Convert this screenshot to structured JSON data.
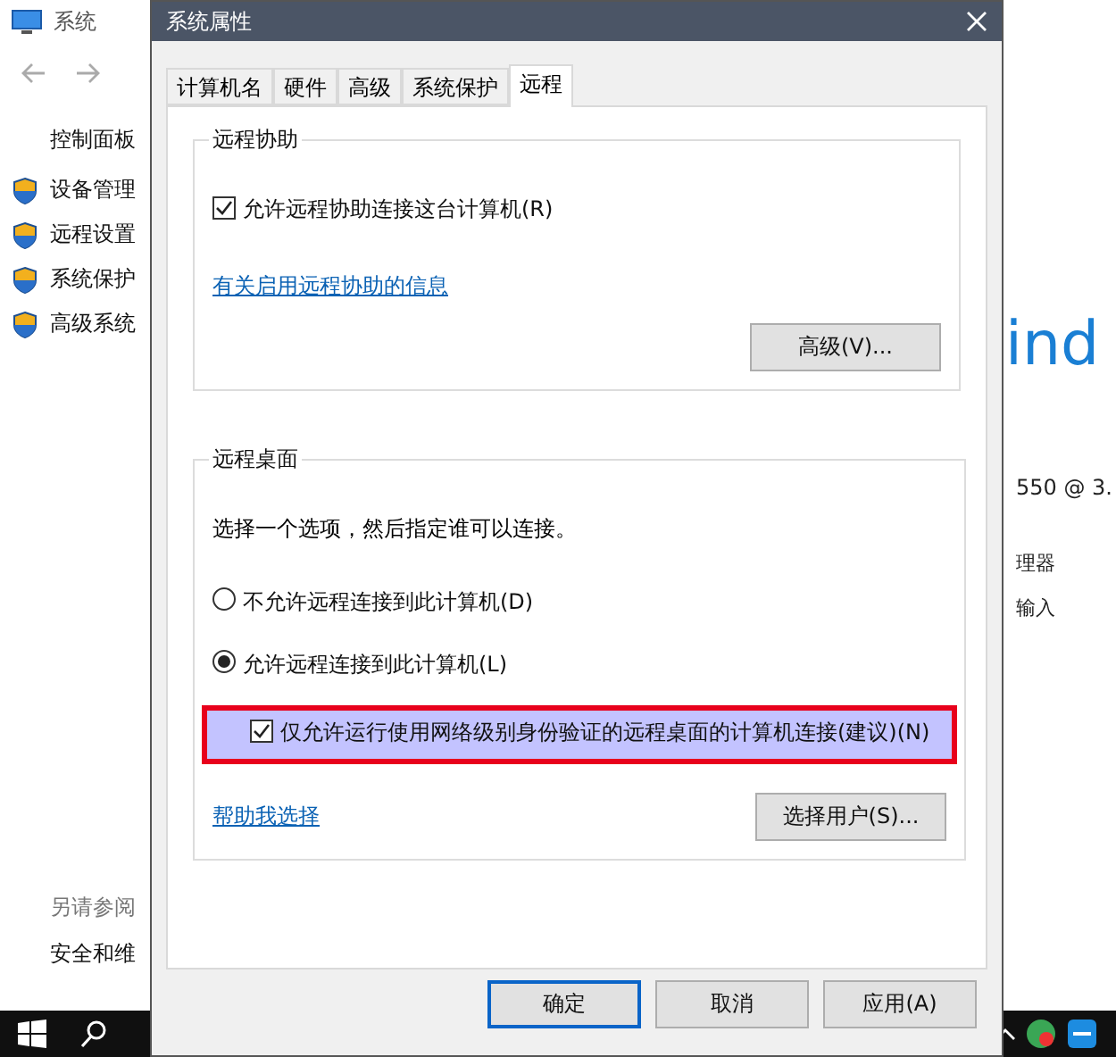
{
  "background_window": {
    "title": "系统",
    "sidebar_home": "控制面板",
    "sidebar_items": [
      "设备管理",
      "远程设置",
      "系统保护",
      "高级系统"
    ],
    "see_also_heading": "另请参阅",
    "see_also_items": [
      "安全和维"
    ],
    "logo_fragment": "ind",
    "processor": "550  @ 3.",
    "detail_lines": [
      "理器",
      "输入"
    ]
  },
  "dialog": {
    "title": "系统属性",
    "tabs": [
      {
        "label": "计算机名",
        "selected": false
      },
      {
        "label": "硬件",
        "selected": false
      },
      {
        "label": "高级",
        "selected": false
      },
      {
        "label": "系统保护",
        "selected": false
      },
      {
        "label": "远程",
        "selected": true
      }
    ],
    "remote_assistance": {
      "heading": "远程协助",
      "allow": {
        "label": "允许远程协助连接这台计算机(R)",
        "checked": true
      },
      "info_link": "有关启用远程协助的信息",
      "advanced_button": "高级(V)..."
    },
    "remote_desktop": {
      "heading": "远程桌面",
      "instruction": "选择一个选项，然后指定谁可以连接。",
      "options": [
        {
          "label": "不允许远程连接到此计算机(D)",
          "selected": false
        },
        {
          "label": "允许远程连接到此计算机(L)",
          "selected": true
        }
      ],
      "nla": {
        "label": "仅允许运行使用网络级别身份验证的远程桌面的计算机连接(建议)(N)",
        "checked": true,
        "highlighted": true
      },
      "help_link": "帮助我选择",
      "select_users_button": "选择用户(S)..."
    },
    "buttons": [
      {
        "label": "确定",
        "default": true
      },
      {
        "label": "取消",
        "default": false
      },
      {
        "label": "应用(A)",
        "default": false
      }
    ]
  }
}
